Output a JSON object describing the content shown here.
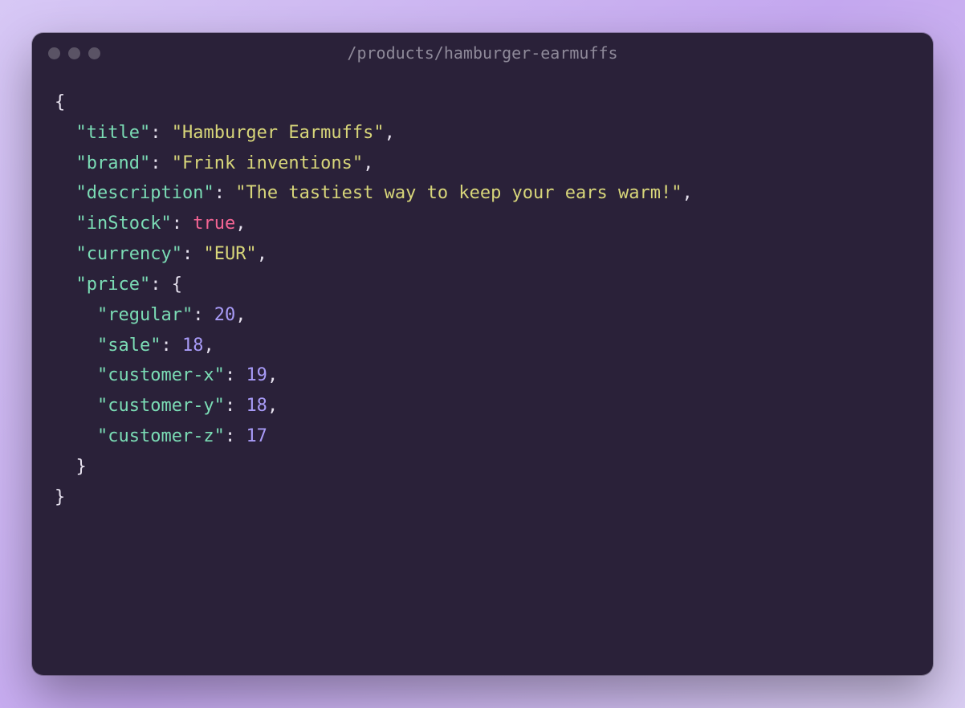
{
  "window": {
    "title": "/products/hamburger-earmuffs"
  },
  "json": {
    "title": {
      "key": "\"title\"",
      "value": "\"Hamburger Earmuffs\""
    },
    "brand": {
      "key": "\"brand\"",
      "value": "\"Frink inventions\""
    },
    "description": {
      "key": "\"description\"",
      "value": "\"The tastiest way to keep your ears warm!\""
    },
    "inStock": {
      "key": "\"inStock\"",
      "value": "true"
    },
    "currency": {
      "key": "\"currency\"",
      "value": "\"EUR\""
    },
    "price": {
      "key": "\"price\"",
      "regular": {
        "key": "\"regular\"",
        "value": "20"
      },
      "sale": {
        "key": "\"sale\"",
        "value": "18"
      },
      "customer_x": {
        "key": "\"customer-x\"",
        "value": "19"
      },
      "customer_y": {
        "key": "\"customer-y\"",
        "value": "18"
      },
      "customer_z": {
        "key": "\"customer-z\"",
        "value": "17"
      }
    }
  }
}
